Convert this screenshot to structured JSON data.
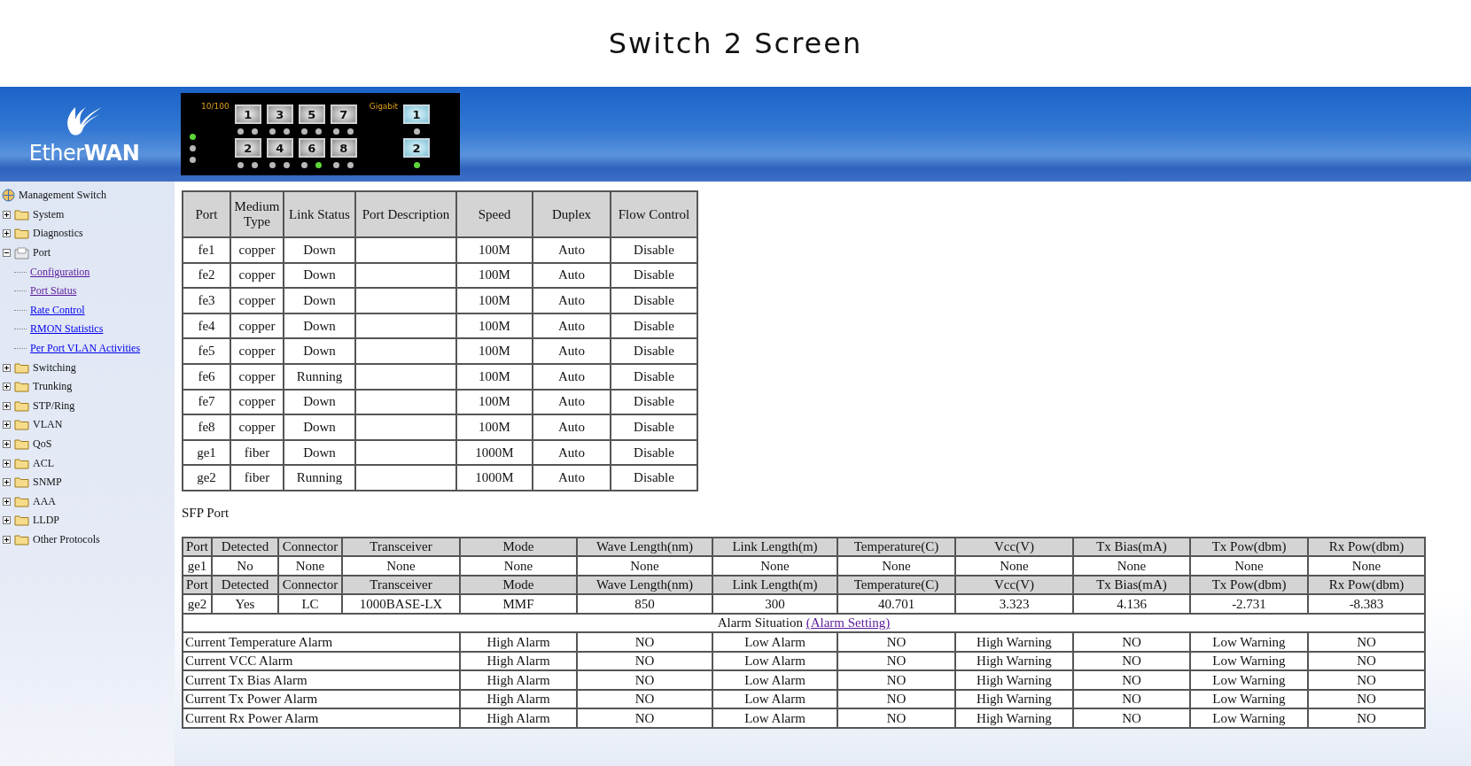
{
  "title": "Switch 2 Screen",
  "logo": "Ether**WAN**",
  "panel": {
    "fast_label": "10/100",
    "gigabit_label": "Gigabit",
    "system_leds": [
      {
        "on": true
      },
      {
        "on": false
      },
      {
        "on": false
      }
    ],
    "fast_ports": [
      {
        "label": "1",
        "leds": [
          {
            "on": false
          },
          {
            "on": false
          }
        ]
      },
      {
        "label": "2",
        "leds": [
          {
            "on": false
          },
          {
            "on": false
          }
        ]
      },
      {
        "label": "3",
        "leds": [
          {
            "on": false
          },
          {
            "on": false
          }
        ]
      },
      {
        "label": "4",
        "leds": [
          {
            "on": false
          },
          {
            "on": false
          }
        ]
      },
      {
        "label": "5",
        "leds": [
          {
            "on": false
          },
          {
            "on": false
          }
        ]
      },
      {
        "label": "6",
        "leds": [
          {
            "on": false
          },
          {
            "on": true
          }
        ]
      },
      {
        "label": "7",
        "leds": [
          {
            "on": false
          },
          {
            "on": false
          }
        ]
      },
      {
        "label": "8",
        "leds": [
          {
            "on": false
          },
          {
            "on": false
          }
        ]
      }
    ],
    "gigabit_ports": [
      {
        "label": "1",
        "led_on": false
      },
      {
        "label": "2",
        "led_on": true
      }
    ]
  },
  "sidebar": {
    "root": "Management Switch",
    "items": [
      {
        "label": "System",
        "expanded": false
      },
      {
        "label": "Diagnostics",
        "expanded": false
      },
      {
        "label": "Port",
        "expanded": true,
        "children": [
          {
            "label": "Configuration",
            "visited": true
          },
          {
            "label": "Port Status",
            "visited": true
          },
          {
            "label": "Rate Control",
            "visited": false
          },
          {
            "label": "RMON Statistics",
            "visited": false
          },
          {
            "label": "Per Port VLAN Activities",
            "visited": false
          }
        ]
      },
      {
        "label": "Switching",
        "expanded": false
      },
      {
        "label": "Trunking",
        "expanded": false
      },
      {
        "label": "STP/Ring",
        "expanded": false
      },
      {
        "label": "VLAN",
        "expanded": false
      },
      {
        "label": "QoS",
        "expanded": false
      },
      {
        "label": "ACL",
        "expanded": false
      },
      {
        "label": "SNMP",
        "expanded": false
      },
      {
        "label": "AAA",
        "expanded": false
      },
      {
        "label": "LLDP",
        "expanded": false
      },
      {
        "label": "Other Protocols",
        "expanded": false
      }
    ]
  },
  "port_table": {
    "columns": [
      "Port",
      "Medium Type",
      "Link Status",
      "Port Description",
      "Speed",
      "Duplex",
      "Flow Control"
    ],
    "rows": [
      {
        "port": "fe1",
        "medium": "copper",
        "link": "Down",
        "speed": "100M",
        "duplex": "Auto",
        "flow": "Disable"
      },
      {
        "port": "fe2",
        "medium": "copper",
        "link": "Down",
        "speed": "100M",
        "duplex": "Auto",
        "flow": "Disable"
      },
      {
        "port": "fe3",
        "medium": "copper",
        "link": "Down",
        "speed": "100M",
        "duplex": "Auto",
        "flow": "Disable"
      },
      {
        "port": "fe4",
        "medium": "copper",
        "link": "Down",
        "speed": "100M",
        "duplex": "Auto",
        "flow": "Disable"
      },
      {
        "port": "fe5",
        "medium": "copper",
        "link": "Down",
        "speed": "100M",
        "duplex": "Auto",
        "flow": "Disable"
      },
      {
        "port": "fe6",
        "medium": "copper",
        "link": "Running",
        "speed": "100M",
        "duplex": "Auto",
        "flow": "Disable"
      },
      {
        "port": "fe7",
        "medium": "copper",
        "link": "Down",
        "speed": "100M",
        "duplex": "Auto",
        "flow": "Disable"
      },
      {
        "port": "fe8",
        "medium": "copper",
        "link": "Down",
        "speed": "100M",
        "duplex": "Auto",
        "flow": "Disable"
      },
      {
        "port": "ge1",
        "medium": "fiber",
        "link": "Down",
        "speed": "1000M",
        "duplex": "Auto",
        "flow": "Disable"
      },
      {
        "port": "ge2",
        "medium": "fiber",
        "link": "Running",
        "speed": "1000M",
        "duplex": "Auto",
        "flow": "Disable"
      }
    ]
  },
  "sfp": {
    "title": "SFP Port",
    "modules": [
      {
        "columns": [
          "Port",
          "Detected",
          "Connector",
          "Transceiver",
          "Mode",
          "Wave Length(nm)",
          "Link Length(m)",
          "Temperature(C)",
          "Vcc(V)",
          "Tx Bias(mA)",
          "Tx Pow(dbm)",
          "Rx Pow(dbm)"
        ],
        "values": [
          "ge1",
          "No",
          "None",
          "None",
          "None",
          "None",
          "None",
          "None",
          "None",
          "None",
          "None",
          "None"
        ]
      },
      {
        "columns": [
          "Port",
          "Detected",
          "Connector",
          "Transceiver",
          "Mode",
          "Wave Length(nm)",
          "Link Length(m)",
          "Temperature(C)",
          "Vcc(V)",
          "Tx Bias(mA)",
          "Tx Pow(dbm)",
          "Rx Pow(dbm)"
        ],
        "values": [
          "ge2",
          "Yes",
          "LC",
          "1000BASE-LX",
          "MMF",
          "850",
          "300",
          "40.701",
          "3.323",
          "4.136",
          "-2.731",
          "-8.383"
        ]
      }
    ],
    "alarm_title": "Alarm Situation",
    "alarm_link": "(Alarm Setting)",
    "alarms": [
      {
        "label": "Current Temperature Alarm",
        "cells": [
          "High Alarm",
          "NO",
          "Low Alarm",
          "NO",
          "High Warning",
          "NO",
          "Low Warning",
          "NO"
        ]
      },
      {
        "label": "Current VCC Alarm",
        "cells": [
          "High Alarm",
          "NO",
          "Low Alarm",
          "NO",
          "High Warning",
          "NO",
          "Low Warning",
          "NO"
        ]
      },
      {
        "label": "Current Tx Bias Alarm",
        "cells": [
          "High Alarm",
          "NO",
          "Low Alarm",
          "NO",
          "High Warning",
          "NO",
          "Low Warning",
          "NO"
        ]
      },
      {
        "label": "Current Tx Power Alarm",
        "cells": [
          "High Alarm",
          "NO",
          "Low Alarm",
          "NO",
          "High Warning",
          "NO",
          "Low Warning",
          "NO"
        ]
      },
      {
        "label": "Current Rx Power Alarm",
        "cells": [
          "High Alarm",
          "NO",
          "Low Alarm",
          "NO",
          "High Warning",
          "NO",
          "Low Warning",
          "NO"
        ]
      }
    ]
  }
}
